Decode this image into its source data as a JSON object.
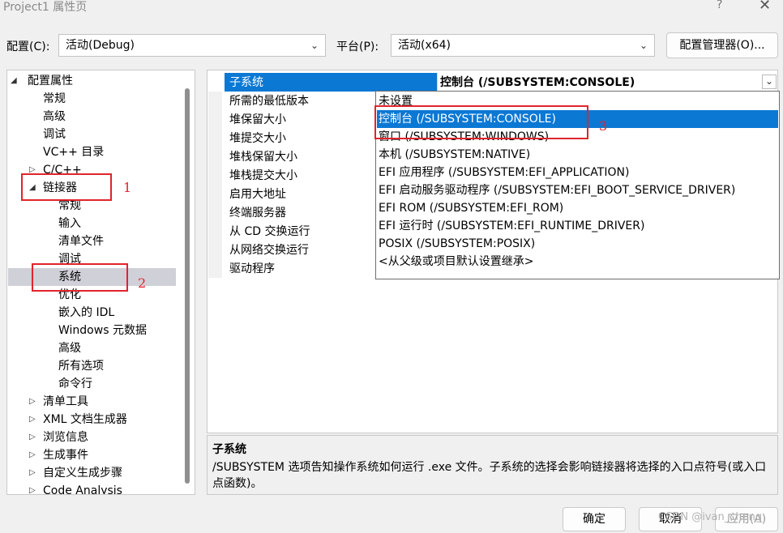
{
  "window": {
    "title": "Project1 属性页",
    "help": "?",
    "close": "✕"
  },
  "top_bar": {
    "config_label": "配置(C):",
    "config_value": "活动(Debug)",
    "platform_label": "平台(P):",
    "platform_value": "活动(x64)",
    "config_manager_button": "配置管理器(O)..."
  },
  "tree": {
    "items": [
      {
        "label": "配置属性",
        "arrow": "◢"
      },
      {
        "label": "常规"
      },
      {
        "label": "高级"
      },
      {
        "label": "调试"
      },
      {
        "label": "VC++ 目录"
      },
      {
        "label": "C/C++",
        "arrow": "▷"
      },
      {
        "label": "链接器",
        "arrow": "◢"
      },
      {
        "label": "常规"
      },
      {
        "label": "输入"
      },
      {
        "label": "清单文件"
      },
      {
        "label": "调试"
      },
      {
        "label": "系统",
        "selected": true
      },
      {
        "label": "优化"
      },
      {
        "label": "嵌入的 IDL"
      },
      {
        "label": "Windows 元数据"
      },
      {
        "label": "高级"
      },
      {
        "label": "所有选项"
      },
      {
        "label": "命令行"
      },
      {
        "label": "清单工具",
        "arrow": "▷"
      },
      {
        "label": "XML 文档生成器",
        "arrow": "▷"
      },
      {
        "label": "浏览信息",
        "arrow": "▷"
      },
      {
        "label": "生成事件",
        "arrow": "▷"
      },
      {
        "label": "自定义生成步骤",
        "arrow": "▷"
      },
      {
        "label": "Code Analysis",
        "arrow": "▷"
      }
    ]
  },
  "properties": {
    "rows": [
      "子系统",
      "所需的最低版本",
      "堆保留大小",
      "堆提交大小",
      "堆栈保留大小",
      "堆栈提交大小",
      "启用大地址",
      "终端服务器",
      "从 CD 交换运行",
      "从网络交换运行",
      "驱动程序"
    ],
    "selected_value": "控制台 (/SUBSYSTEM:CONSOLE)"
  },
  "dropdown": {
    "options": [
      "未设置",
      "控制台 (/SUBSYSTEM:CONSOLE)",
      "窗口 (/SUBSYSTEM:WINDOWS)",
      "本机 (/SUBSYSTEM:NATIVE)",
      "EFI 应用程序 (/SUBSYSTEM:EFI_APPLICATION)",
      "EFI 启动服务驱动程序 (/SUBSYSTEM:EFI_BOOT_SERVICE_DRIVER)",
      "EFI ROM (/SUBSYSTEM:EFI_ROM)",
      "EFI 运行时 (/SUBSYSTEM:EFI_RUNTIME_DRIVER)",
      "POSIX (/SUBSYSTEM:POSIX)",
      "<从父级或项目默认设置继承>"
    ],
    "selected_index": 1
  },
  "description": {
    "title": "子系统",
    "text": "/SUBSYSTEM 选项告知操作系统如何运行 .exe 文件。子系统的选择会影响链接器将选择的入口点符号(或入口点函数)。"
  },
  "footer": {
    "ok": "确定",
    "cancel": "取消",
    "apply": "应用(A)"
  },
  "annotations": {
    "n1": "1",
    "n2": "2",
    "n3": "3",
    "color": "#e0242c"
  },
  "watermark": "CSDN @ivan_cheng",
  "colors": {
    "accent": "#0b78d4",
    "tree_selected": "#cfd0d8"
  }
}
